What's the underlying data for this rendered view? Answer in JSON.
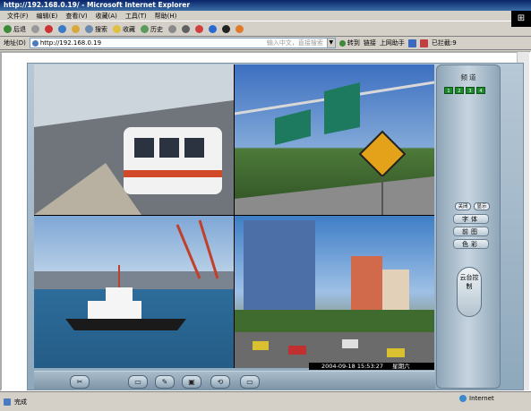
{
  "window": {
    "title": "http://192.168.0.19/ - Microsoft Internet Explorer"
  },
  "menu": [
    "文件(F)",
    "编辑(E)",
    "查看(V)",
    "收藏(A)",
    "工具(T)",
    "帮助(H)"
  ],
  "toolbar": {
    "back": "后退",
    "search": "搜索",
    "favorites": "收藏",
    "history": "历史"
  },
  "address": {
    "label": "地址(D)",
    "url": "http://192.168.0.19",
    "search_placeholder": "输入中文，直接搜索",
    "go": "转到",
    "links": "链接",
    "assistant": "上网助手",
    "blocked": "已拦截:9"
  },
  "panel": {
    "title": "频道",
    "channels": [
      "1",
      "2",
      "3",
      "4"
    ],
    "small_buttons": [
      "关闭",
      "显示"
    ],
    "menu_items": [
      "字体",
      "前图",
      "色彩"
    ],
    "ptz_label": "云台控制"
  },
  "video": {
    "timestamp": "2004-09-18 15:53:27",
    "weekday": "星期六"
  },
  "bottom_buttons": [
    "✂",
    "▭",
    "✎",
    "▣",
    "⟲",
    "▭"
  ],
  "status": {
    "left": "完成",
    "zone": "Internet"
  }
}
